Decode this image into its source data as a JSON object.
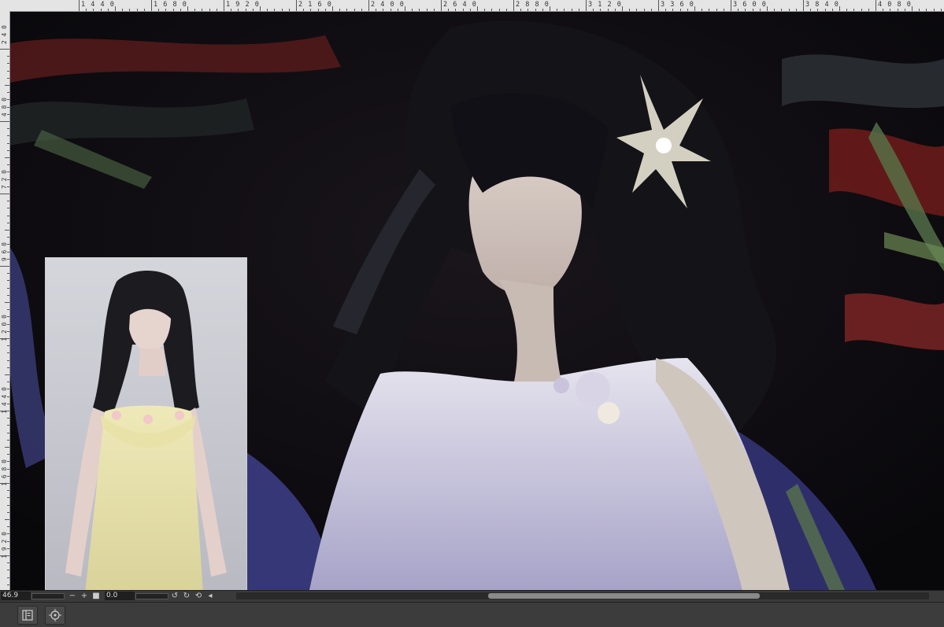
{
  "ruler": {
    "top_labels": [
      "1440",
      "1680",
      "1920",
      "2160",
      "2400",
      "2640",
      "2880",
      "3120",
      "3360",
      "3600",
      "3840",
      "4080"
    ],
    "left_labels": [
      "240",
      "480",
      "720",
      "960",
      "1200",
      "1440",
      "1680",
      "1920"
    ]
  },
  "canvas": {
    "background_color": "#0c0a0d",
    "accent_red": "#7a2020",
    "accent_blue": "#4c4c9a",
    "accent_green": "#5d7a4a"
  },
  "status": {
    "zoom_value": "46.9",
    "zoom_out": "−",
    "zoom_in": "+",
    "angle_value": "0.0"
  },
  "icons": {
    "zoom_out": "minus-icon",
    "zoom_in": "plus-icon",
    "rotate_left": "rotate-left-icon",
    "rotate_right": "rotate-right-icon",
    "reset": "reset-icon",
    "navigator": "navigator-icon",
    "fit": "fit-icon"
  }
}
